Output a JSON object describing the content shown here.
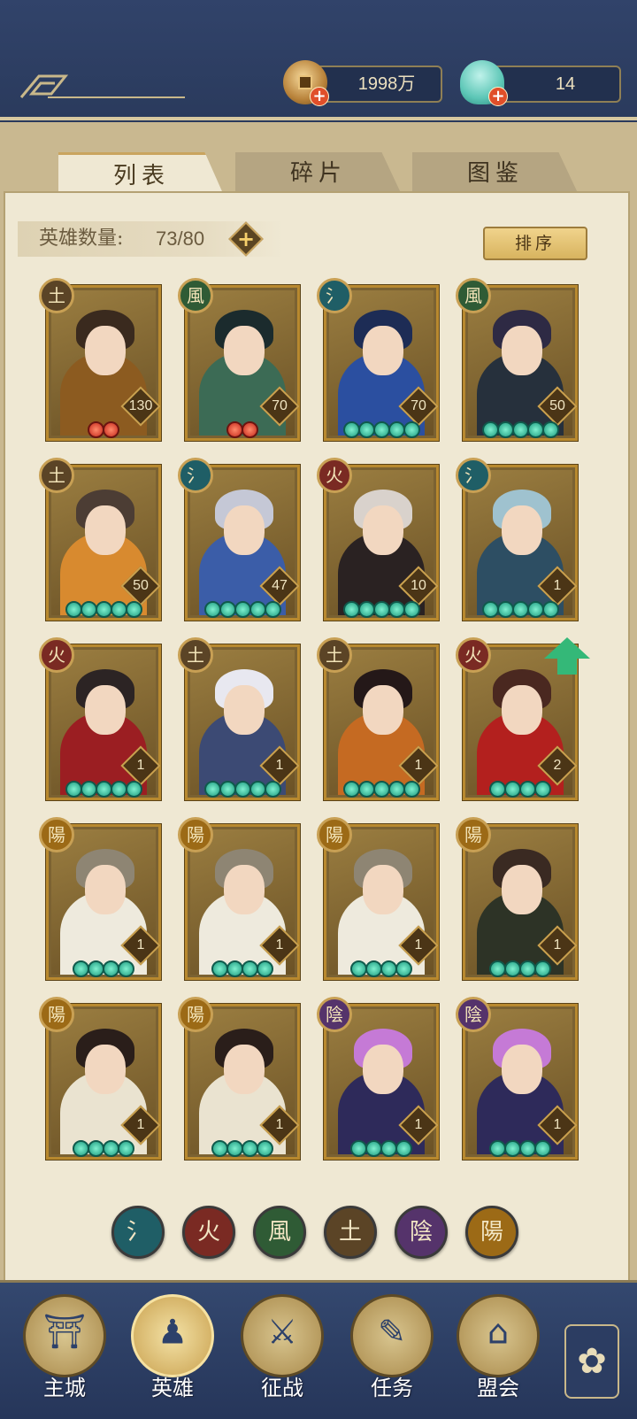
{
  "currencies": {
    "coin": {
      "value": "1998万",
      "icon": "coin-icon",
      "plus": "+"
    },
    "jade": {
      "value": "14",
      "icon": "jade-shell-icon",
      "plus": "+"
    }
  },
  "tabs": [
    {
      "label": "列表",
      "active": true
    },
    {
      "label": "碎片",
      "active": false
    },
    {
      "label": "图鉴",
      "active": false
    }
  ],
  "hero_count": {
    "label": "英雄数量:",
    "value": "73/80",
    "plus": "+"
  },
  "sort_label": "排序",
  "element_glyphs": {
    "water": "氵",
    "fire": "火",
    "wind": "風",
    "earth": "土",
    "yin": "陰",
    "yang": "陽"
  },
  "element_colors": {
    "water": "#1f5e66",
    "fire": "#7a2a23",
    "wind": "#2f5b35",
    "earth": "#5b4426",
    "yin": "#55336b",
    "yang": "#9c6a16"
  },
  "heroes": [
    {
      "element": "earth",
      "level": "130",
      "stars": 2,
      "star_color": "red",
      "hair": "#3a2a1e",
      "outfit": "#8c5b20"
    },
    {
      "element": "wind",
      "level": "70",
      "stars": 2,
      "star_color": "red",
      "hair": "#1b2b2d",
      "outfit": "#3c6b55"
    },
    {
      "element": "water",
      "level": "70",
      "stars": 5,
      "star_color": "jade",
      "hair": "#1d2c55",
      "outfit": "#2b4fa0"
    },
    {
      "element": "wind",
      "level": "50",
      "stars": 5,
      "star_color": "jade",
      "hair": "#2e2a44",
      "outfit": "#26303c"
    },
    {
      "element": "earth",
      "level": "50",
      "stars": 5,
      "star_color": "jade",
      "hair": "#4c3d34",
      "outfit": "#d88a2f"
    },
    {
      "element": "water",
      "level": "47",
      "stars": 5,
      "star_color": "jade",
      "hair": "#c5c8d6",
      "outfit": "#3b5da8"
    },
    {
      "element": "fire",
      "level": "10",
      "stars": 5,
      "star_color": "jade",
      "hair": "#d9d2cc",
      "outfit": "#2a2222"
    },
    {
      "element": "water",
      "level": "1",
      "stars": 5,
      "star_color": "jade",
      "hair": "#9fc2cf",
      "outfit": "#2d4e63"
    },
    {
      "element": "fire",
      "level": "1",
      "stars": 5,
      "star_color": "jade",
      "hair": "#2c2424",
      "outfit": "#9b1e22"
    },
    {
      "element": "earth",
      "level": "1",
      "stars": 5,
      "star_color": "jade",
      "hair": "#e8e8f0",
      "outfit": "#3c4a74"
    },
    {
      "element": "earth",
      "level": "1",
      "stars": 5,
      "star_color": "jade",
      "hair": "#241818",
      "outfit": "#c56a22"
    },
    {
      "element": "fire",
      "level": "2",
      "stars": 4,
      "star_color": "jade",
      "hair": "#4a2820",
      "outfit": "#b3201e",
      "upgrade": true
    },
    {
      "element": "yang",
      "level": "1",
      "stars": 4,
      "star_color": "jade",
      "hair": "#8e8573",
      "outfit": "#eeeadd"
    },
    {
      "element": "yang",
      "level": "1",
      "stars": 4,
      "star_color": "jade",
      "hair": "#8e8573",
      "outfit": "#eeeadd"
    },
    {
      "element": "yang",
      "level": "1",
      "stars": 4,
      "star_color": "jade",
      "hair": "#8e8573",
      "outfit": "#eeeadd"
    },
    {
      "element": "yang",
      "level": "1",
      "stars": 4,
      "star_color": "jade",
      "hair": "#3a2a22",
      "outfit": "#2d3326"
    },
    {
      "element": "yang",
      "level": "1",
      "stars": 4,
      "star_color": "jade",
      "hair": "#2a1e1a",
      "outfit": "#eae3d0"
    },
    {
      "element": "yang",
      "level": "1",
      "stars": 4,
      "star_color": "jade",
      "hair": "#2a1e1a",
      "outfit": "#eae3d0"
    },
    {
      "element": "yin",
      "level": "1",
      "stars": 4,
      "star_color": "jade",
      "hair": "#c57ad6",
      "outfit": "#2e2a5a"
    },
    {
      "element": "yin",
      "level": "1",
      "stars": 4,
      "star_color": "jade",
      "hair": "#c57ad6",
      "outfit": "#2e2a5a"
    }
  ],
  "filters": [
    {
      "element": "water",
      "glyph": "氵"
    },
    {
      "element": "fire",
      "glyph": "火"
    },
    {
      "element": "wind",
      "glyph": "風"
    },
    {
      "element": "earth",
      "glyph": "土"
    },
    {
      "element": "yin",
      "glyph": "陰"
    },
    {
      "element": "yang",
      "glyph": "陽"
    }
  ],
  "nav": [
    {
      "label": "主城",
      "icon": "city-gate-icon",
      "glyph": "⛩"
    },
    {
      "label": "英雄",
      "icon": "hero-portrait-icon",
      "glyph": "♟",
      "active": true
    },
    {
      "label": "征战",
      "icon": "battle-scroll-icon",
      "glyph": "⚔"
    },
    {
      "label": "任务",
      "icon": "quest-book-icon",
      "glyph": "✎"
    },
    {
      "label": "盟会",
      "icon": "alliance-pavilion-icon",
      "glyph": "⌂"
    }
  ],
  "menu_icon": "menu-flower-icon",
  "menu_glyph": "✿"
}
